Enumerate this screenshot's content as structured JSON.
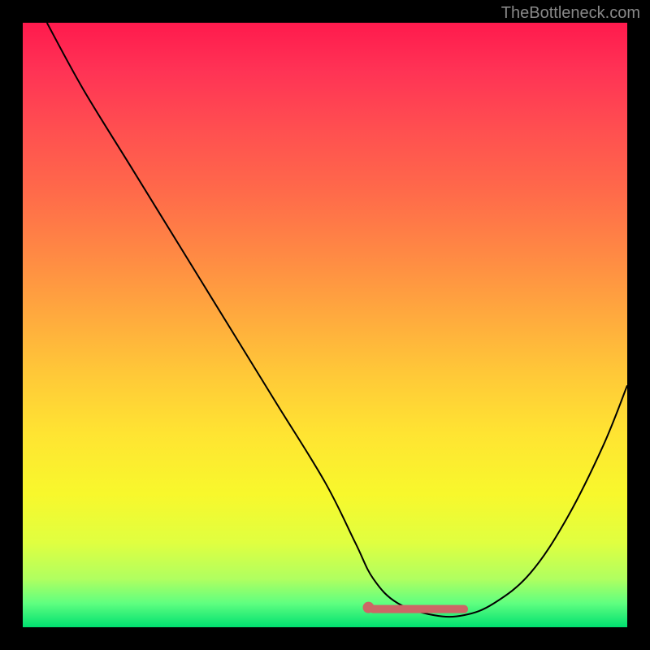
{
  "watermark": "TheBottleneck.com",
  "chart_data": {
    "type": "line",
    "title": "",
    "xlabel": "",
    "ylabel": "",
    "xlim": [
      0,
      100
    ],
    "ylim": [
      0,
      100
    ],
    "background_gradient": {
      "top": "#ff1a4d",
      "bottom": "#00e070"
    },
    "curve": {
      "name": "bottleneck-curve",
      "x": [
        4,
        10,
        18,
        26,
        34,
        42,
        50,
        55,
        58,
        62,
        68,
        73,
        78,
        84,
        90,
        96,
        100
      ],
      "y": [
        100,
        89,
        76,
        63,
        50,
        37,
        24,
        14,
        8,
        4,
        2,
        2,
        4,
        9,
        18,
        30,
        40
      ]
    },
    "highlight_segment": {
      "name": "optimal-zone",
      "color": "#cc6666",
      "x": [
        58,
        73
      ],
      "y": [
        3,
        3
      ]
    }
  }
}
